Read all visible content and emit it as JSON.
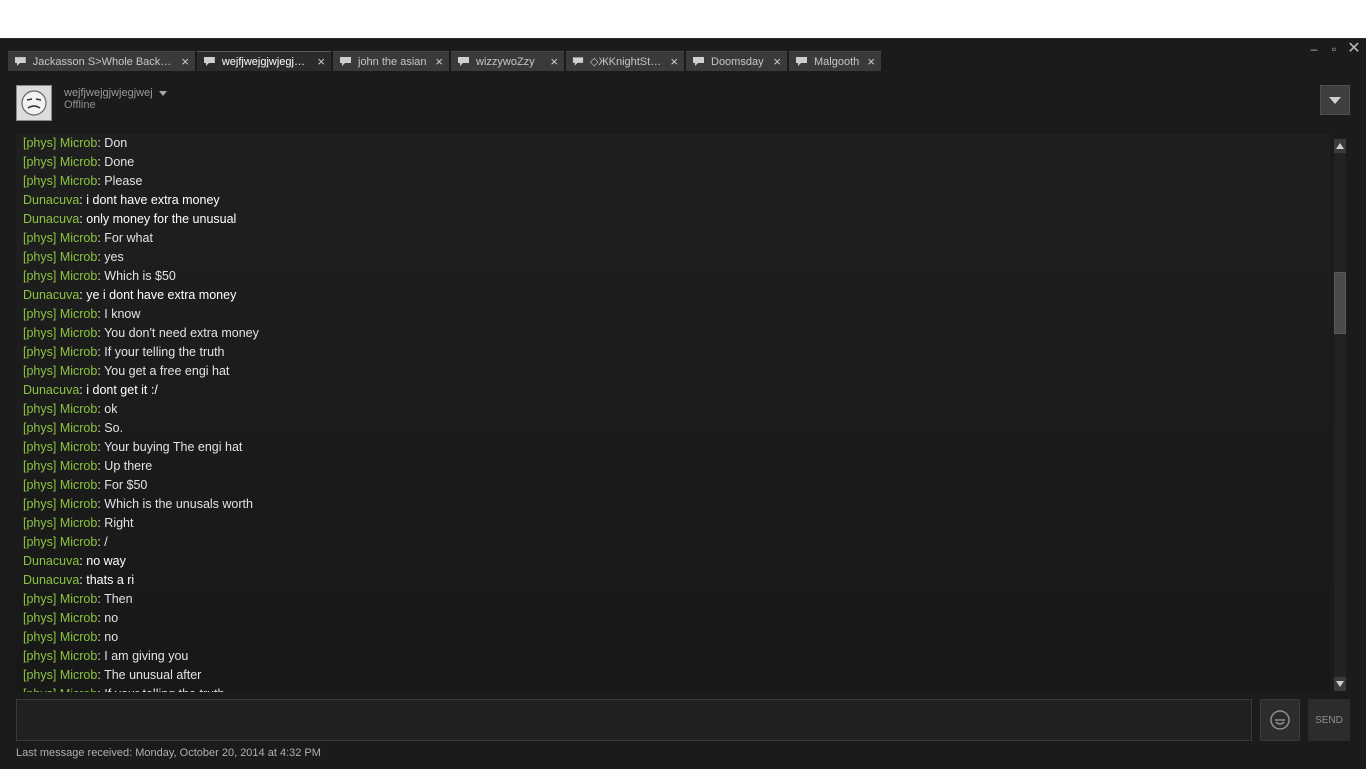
{
  "window": {
    "controls": {
      "minimize": "–",
      "maximize": "▫",
      "close": "✕"
    }
  },
  "tabs": [
    {
      "label": "Jackasson S>Whole Backp...",
      "active": false
    },
    {
      "label": "wejfjwejgjwjegjwej",
      "active": true
    },
    {
      "label": "john the asian",
      "active": false
    },
    {
      "label": "wizzywoZzy",
      "active": false
    },
    {
      "label": "◇ЖKnightStar◇",
      "active": false
    },
    {
      "label": "Doomsday",
      "active": false
    },
    {
      "label": "Malgooth",
      "active": false
    }
  ],
  "tab_close_glyph": "×",
  "friend": {
    "name": "wejfjwejgjwjegjwej",
    "status": "Offline"
  },
  "chat_messages": [
    {
      "who": "[phys] Microb",
      "text": ": Don",
      "mine": false
    },
    {
      "who": "[phys] Microb",
      "text": ": Done",
      "mine": false
    },
    {
      "who": "[phys] Microb",
      "text": ": Please",
      "mine": false
    },
    {
      "who": "Dunacuva",
      "text": ": i dont have extra money",
      "mine": true
    },
    {
      "who": "Dunacuva",
      "text": ": only money for the unusual",
      "mine": true
    },
    {
      "who": "[phys] Microb",
      "text": ": For what",
      "mine": false
    },
    {
      "who": "[phys] Microb",
      "text": ": yes",
      "mine": false
    },
    {
      "who": "[phys] Microb",
      "text": ": Which is $50",
      "mine": false
    },
    {
      "who": "Dunacuva",
      "text": ": ye i dont have extra money",
      "mine": true
    },
    {
      "who": "[phys] Microb",
      "text": ": I know",
      "mine": false
    },
    {
      "who": "[phys] Microb",
      "text": ": You don't need extra money",
      "mine": false
    },
    {
      "who": "[phys] Microb",
      "text": ": If your telling the truth",
      "mine": false
    },
    {
      "who": "[phys] Microb",
      "text": ": You get a free engi hat",
      "mine": false
    },
    {
      "who": "Dunacuva",
      "text": ": i dont get it :/",
      "mine": true
    },
    {
      "who": "[phys] Microb",
      "text": ": ok",
      "mine": false
    },
    {
      "who": "[phys] Microb",
      "text": ": So.",
      "mine": false
    },
    {
      "who": "[phys] Microb",
      "text": ": Your buying The engi hat",
      "mine": false
    },
    {
      "who": "[phys] Microb",
      "text": ": Up there",
      "mine": false
    },
    {
      "who": "[phys] Microb",
      "text": ": For $50",
      "mine": false
    },
    {
      "who": "[phys] Microb",
      "text": ": Which is the unusals worth",
      "mine": false
    },
    {
      "who": "[phys] Microb",
      "text": ": Right",
      "mine": false
    },
    {
      "who": "[phys] Microb",
      "text": ": /",
      "mine": false
    },
    {
      "who": "Dunacuva",
      "text": ": no way",
      "mine": true
    },
    {
      "who": "Dunacuva",
      "text": ": thats a ri",
      "mine": true
    },
    {
      "who": "[phys] Microb",
      "text": ": Then",
      "mine": false
    },
    {
      "who": "[phys] Microb",
      "text": ": no",
      "mine": false
    },
    {
      "who": "[phys] Microb",
      "text": ": no",
      "mine": false
    },
    {
      "who": "[phys] Microb",
      "text": ": I am giving you",
      "mine": false
    },
    {
      "who": "[phys] Microb",
      "text": ": The unusual after",
      "mine": false
    },
    {
      "who": "[phys] Microb",
      "text": ": If your telling the truth",
      "mine": false
    }
  ],
  "input": {
    "value": ""
  },
  "send_label": "SEND",
  "footer": "Last message received: Monday, October 20, 2014 at 4:32 PM",
  "icons": {
    "tab": "chat-bubble-icon",
    "menu": "dropdown-triangle-icon",
    "emote": "emoticon-icon"
  }
}
